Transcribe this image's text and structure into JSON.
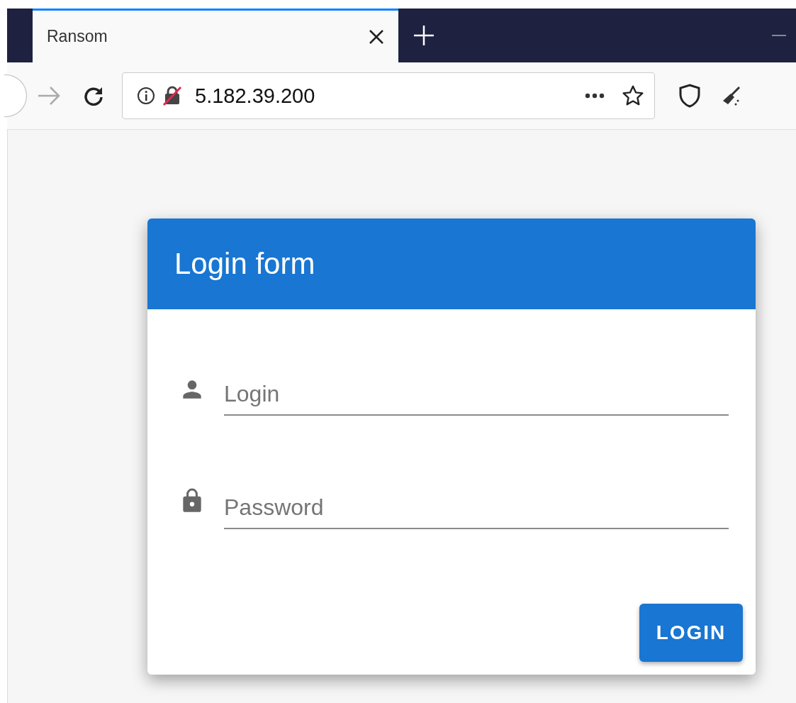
{
  "browser": {
    "tab": {
      "title": "Ransom",
      "selected": true
    },
    "address": "5.182.39.200"
  },
  "login_form": {
    "title": "Login form",
    "fields": [
      {
        "kind": "user",
        "placeholder": "Login"
      },
      {
        "kind": "password",
        "placeholder": "Password"
      }
    ],
    "button": "LOGIN"
  }
}
